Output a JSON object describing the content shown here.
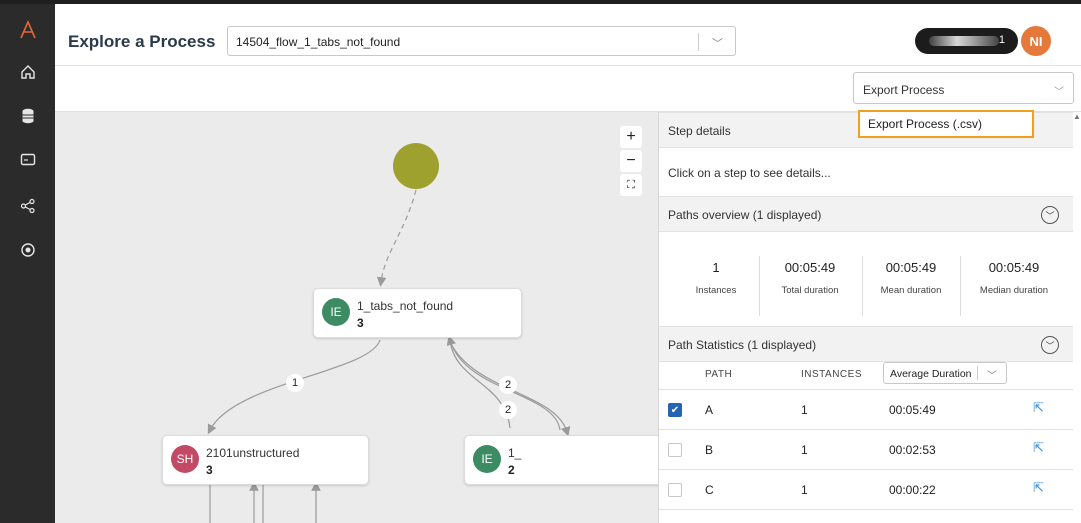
{
  "header": {
    "title": "Explore a Process",
    "process_value": "14504_flow_1_tabs_not_found",
    "user_digit": "1",
    "avatar_initials": "NI"
  },
  "sidebar": {
    "items": [
      "logo-icon",
      "home-icon",
      "database-icon",
      "monitor-icon",
      "share-icon",
      "target-icon"
    ]
  },
  "toolbar": {
    "export_label": "Export Process",
    "export_menu_item": "Export Process (.csv)"
  },
  "canvas": {
    "zoom_in": "+",
    "zoom_out": "−",
    "fit": "⛶",
    "nodes": [
      {
        "badge": "IE",
        "label": "1_tabs_not_found",
        "count": "3",
        "color": "#3d8b62"
      },
      {
        "badge": "SH",
        "label": "2101unstructured",
        "count": "3",
        "color": "#c24a64"
      },
      {
        "badge": "IE",
        "label": "1_",
        "count": "2",
        "color": "#3d8b62"
      }
    ],
    "edge_labels": [
      "1",
      "2",
      "2"
    ],
    "start_color": "#9fa12e"
  },
  "panel": {
    "step_details_title": "Step details",
    "hint": "Click on a step to see details...",
    "paths_overview_title": "Paths overview (1 displayed)",
    "stats": [
      {
        "value": "1",
        "label": "Instances"
      },
      {
        "value": "00:05:49",
        "label": "Total duration"
      },
      {
        "value": "00:05:49",
        "label": "Mean duration"
      },
      {
        "value": "00:05:49",
        "label": "Median duration"
      }
    ],
    "path_stats_title": "Path Statistics (1 displayed)",
    "columns": {
      "path": "PATH",
      "instances": "INSTANCES",
      "duration_select": "Average Duration"
    },
    "rows": [
      {
        "path": "A",
        "instances": "1",
        "duration": "00:05:49",
        "checked": true
      },
      {
        "path": "B",
        "instances": "1",
        "duration": "00:02:53",
        "checked": false
      },
      {
        "path": "C",
        "instances": "1",
        "duration": "00:00:22",
        "checked": false
      }
    ]
  }
}
